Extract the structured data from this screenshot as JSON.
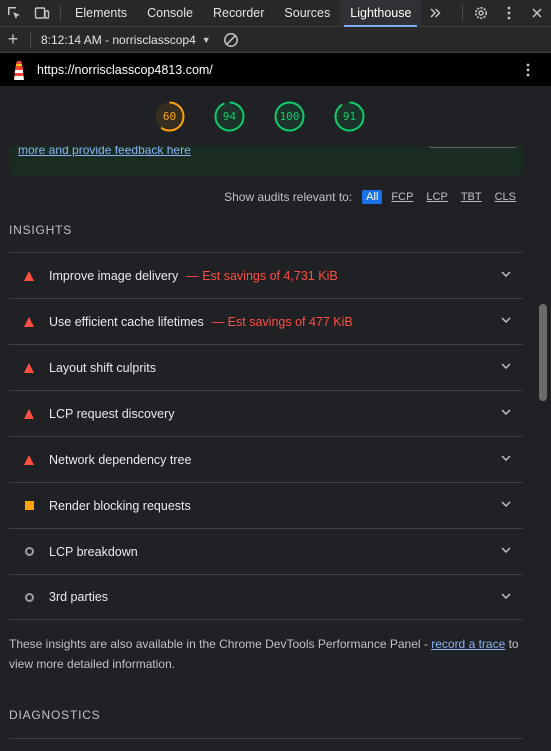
{
  "tabbar": {
    "tabs": [
      {
        "label": "Elements"
      },
      {
        "label": "Console"
      },
      {
        "label": "Recorder"
      },
      {
        "label": "Sources"
      },
      {
        "label": "Lighthouse",
        "active": true
      }
    ],
    "more_tabs_icon": "double-chevron-right-icon"
  },
  "toolbar": {
    "report_label": "8:12:14 AM - norrisclasscop4"
  },
  "urlbar": {
    "url": "https://norrisclasscop4813.com/"
  },
  "scores": [
    {
      "value": "60",
      "level": "average",
      "color": "#ffa400",
      "fraction": 0.6
    },
    {
      "value": "94",
      "level": "pass",
      "color": "#0cce6b",
      "fraction": 0.94
    },
    {
      "value": "100",
      "level": "pass",
      "color": "#0cce6b",
      "fraction": 1.0
    },
    {
      "value": "91",
      "level": "pass",
      "color": "#0cce6b",
      "fraction": 0.91
    }
  ],
  "feedback": {
    "link_text": "more and provide feedback here"
  },
  "filter": {
    "label": "Show audits relevant to:",
    "chips": [
      "All",
      "FCP",
      "LCP",
      "TBT",
      "CLS"
    ],
    "active": "All"
  },
  "insights": {
    "title": "INSIGHTS",
    "audits": [
      {
        "title": "Improve image delivery",
        "savings": "— Est savings of 4,731 KiB",
        "status": "fail"
      },
      {
        "title": "Use efficient cache lifetimes",
        "savings": "— Est savings of 477 KiB",
        "status": "fail"
      },
      {
        "title": "Layout shift culprits",
        "savings": "",
        "status": "fail"
      },
      {
        "title": "LCP request discovery",
        "savings": "",
        "status": "fail"
      },
      {
        "title": "Network dependency tree",
        "savings": "",
        "status": "fail"
      },
      {
        "title": "Render blocking requests",
        "savings": "",
        "status": "average"
      },
      {
        "title": "LCP breakdown",
        "savings": "",
        "status": "info"
      },
      {
        "title": "3rd parties",
        "savings": "",
        "status": "info"
      }
    ],
    "note_prefix": "These insights are also available in the Chrome DevTools Performance Panel - ",
    "note_link": "record a trace",
    "note_suffix": " to view more detailed information."
  },
  "diagnostics": {
    "title": "DIAGNOSTICS"
  },
  "colors": {
    "fail": "#ff4e42",
    "average": "#ffa400",
    "pass": "#0cce6b",
    "accent": "#7cacf8"
  }
}
